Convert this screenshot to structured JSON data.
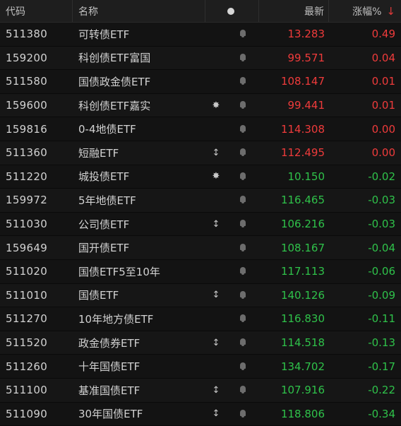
{
  "header": {
    "code": "代码",
    "name": "名称",
    "price": "最新",
    "change": "涨幅%",
    "sort_arrow": "↓"
  },
  "colors": {
    "up": "#ef3b3b",
    "down": "#2fc24a"
  },
  "rows": [
    {
      "code": "511380",
      "name": "可转债ETF",
      "icon": "",
      "price": "13.283",
      "change": "0.49",
      "trend": "up"
    },
    {
      "code": "159200",
      "name": "科创债ETF富国",
      "icon": "",
      "price": "99.571",
      "change": "0.04",
      "trend": "up"
    },
    {
      "code": "511580",
      "name": "国债政金债ETF",
      "icon": "",
      "price": "108.147",
      "change": "0.01",
      "trend": "up"
    },
    {
      "code": "159600",
      "name": "科创债ETF嘉实",
      "icon": "✸",
      "price": "99.441",
      "change": "0.01",
      "trend": "up"
    },
    {
      "code": "159816",
      "name": "0-4地债ETF",
      "icon": "",
      "price": "114.308",
      "change": "0.00",
      "trend": "up"
    },
    {
      "code": "511360",
      "name": "短融ETF",
      "icon": "↕",
      "price": "112.495",
      "change": "0.00",
      "trend": "up"
    },
    {
      "code": "511220",
      "name": "城投债ETF",
      "icon": "✸",
      "price": "10.150",
      "change": "-0.02",
      "trend": "down"
    },
    {
      "code": "159972",
      "name": "5年地债ETF",
      "icon": "",
      "price": "116.465",
      "change": "-0.03",
      "trend": "down"
    },
    {
      "code": "511030",
      "name": "公司债ETF",
      "icon": "↕",
      "price": "106.216",
      "change": "-0.03",
      "trend": "down"
    },
    {
      "code": "159649",
      "name": "国开债ETF",
      "icon": "",
      "price": "108.167",
      "change": "-0.04",
      "trend": "down"
    },
    {
      "code": "511020",
      "name": "国债ETF5至10年",
      "icon": "",
      "price": "117.113",
      "change": "-0.06",
      "trend": "down"
    },
    {
      "code": "511010",
      "name": "国债ETF",
      "icon": "↕",
      "price": "140.126",
      "change": "-0.09",
      "trend": "down"
    },
    {
      "code": "511270",
      "name": "10年地方债ETF",
      "icon": "",
      "price": "116.830",
      "change": "-0.11",
      "trend": "down"
    },
    {
      "code": "511520",
      "name": "政金债券ETF",
      "icon": "↕",
      "price": "114.518",
      "change": "-0.13",
      "trend": "down"
    },
    {
      "code": "511260",
      "name": "十年国债ETF",
      "icon": "",
      "price": "134.702",
      "change": "-0.17",
      "trend": "down"
    },
    {
      "code": "511100",
      "name": "基准国债ETF",
      "icon": "↕",
      "price": "107.916",
      "change": "-0.22",
      "trend": "down"
    },
    {
      "code": "511090",
      "name": "30年国债ETF",
      "icon": "↕",
      "price": "118.806",
      "change": "-0.34",
      "trend": "down"
    }
  ]
}
